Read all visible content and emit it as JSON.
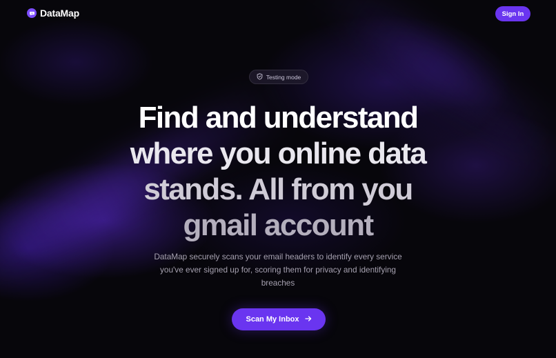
{
  "brand": {
    "name": "DataMap",
    "logo_icon": "chat-bubble-icon",
    "accent_color": "#6a35f0"
  },
  "header": {
    "signin_label": "Sign In"
  },
  "badge": {
    "icon": "shield-check-icon",
    "label": "Testing mode"
  },
  "hero": {
    "headline_lines": [
      "Find and understand",
      "where you online data",
      "stands. All from you",
      "gmail account"
    ],
    "description_lines": [
      "DataMap securely scans your email headers to identify every service",
      "you've ever signed up for, scoring them for privacy and identifying",
      "breaches"
    ],
    "cta_label": "Scan My Inbox",
    "cta_icon": "arrow-right-icon"
  }
}
